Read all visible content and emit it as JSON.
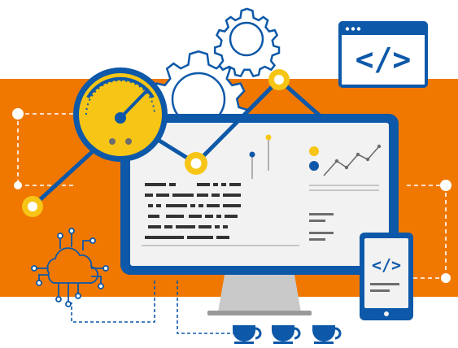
{
  "colors": {
    "orange": "#F07800",
    "blue": "#0D58A8",
    "dark_blue": "#0B4C93",
    "yellow": "#F7C516",
    "screen_bg": "#F2F2F2",
    "gray_line": "#6D6D6D",
    "stand_gray": "#C9C9C9",
    "white": "#FFFFFF"
  },
  "illustration": {
    "code_window_symbol": "</>",
    "tablet_code_symbol": "</>",
    "cup_count": 3,
    "icons": [
      "gauge-icon",
      "gear-icon",
      "code-window-icon",
      "cloud-circuit-icon",
      "monitor-icon",
      "tablet-icon",
      "cup-icon"
    ]
  }
}
